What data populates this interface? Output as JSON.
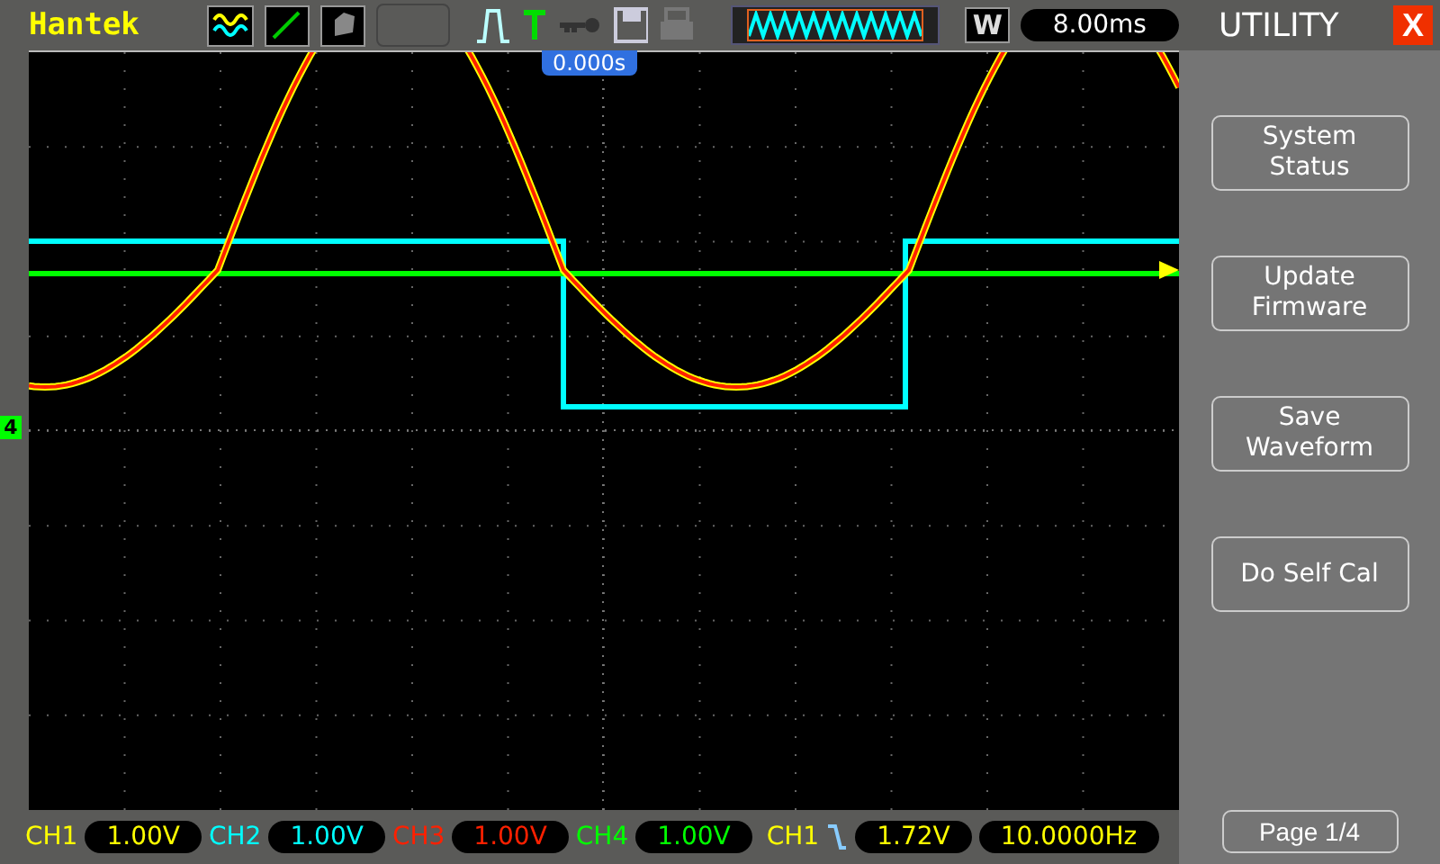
{
  "brand": "Hantek",
  "time_offset": "0.000s",
  "window_key": "W",
  "timebase": "8.00ms",
  "menu": {
    "title": "UTILITY",
    "close": "X",
    "buttons": [
      "System\nStatus",
      "Update\nFirmware",
      "Save\nWaveform",
      "Do Self Cal"
    ],
    "page": "Page 1/4"
  },
  "ground_marker": "4",
  "channels": [
    {
      "label": "CH1",
      "value": "1.00V",
      "color": "#ffff00"
    },
    {
      "label": "CH2",
      "value": "1.00V",
      "color": "#00ffff"
    },
    {
      "label": "CH3",
      "value": "1.00V",
      "color": "#ff2000"
    },
    {
      "label": "CH4",
      "value": "1.00V",
      "color": "#00ff00"
    }
  ],
  "trigger": {
    "source": "CH1",
    "level": "1.72V"
  },
  "frequency": "10.0000Hz"
}
